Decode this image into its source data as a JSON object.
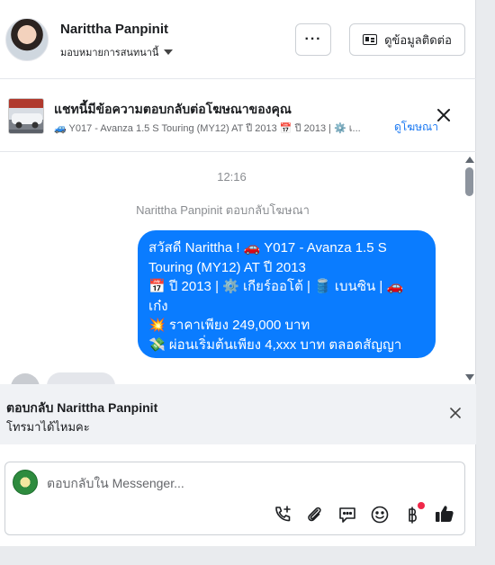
{
  "header": {
    "name": "Narittha Panpinit",
    "assign_label": "มอบหมายการสนทนานี้",
    "more_label": "···",
    "contact_label": "ดูข้อมูลติดต่อ"
  },
  "ad_banner": {
    "title": "แชทนี้มีข้อความตอบกลับต่อโฆษณาของคุณ",
    "subtitle": "🚙 Y017 - Avanza 1.5 S Touring (MY12) AT ปี 2013 📅 ปี 2013 | ⚙️ เ...",
    "link_label": "ดูโฆษณา"
  },
  "messages": {
    "timestamp": "12:16",
    "reply_note": "Narittha Panpinit ตอบกลับโฆษณา",
    "bubble_lines": [
      "สวัสดี Narittha ! 🚗 Y017 - Avanza 1.5 S",
      "Touring (MY12) AT ปี 2013",
      "📅 ปี 2013 | ⚙️ เกียร์ออโต้ | 🛢️ เบนซิน | 🚗",
      "เก๋ง",
      "💥 ราคาเพียง 249,000 บาท",
      "💸 ผ่อนเริ่มต้นเพียง 4,xxx บาท ตลอดสัญญา"
    ]
  },
  "reply_to": {
    "title": "ตอบกลับ Narittha Panpinit",
    "text": "โทรมาได้ไหมคะ"
  },
  "composer": {
    "placeholder": "ตอบกลับใน Messenger..."
  },
  "colors": {
    "bubble": "#0a7cff",
    "link": "#1877f2",
    "notification_dot": "#f02849"
  },
  "icons": [
    "call-add-icon",
    "attachment-icon",
    "chat-icon",
    "emoji-icon",
    "baht-icon",
    "thumbs-up-icon",
    "close-icon",
    "more-icon",
    "contact-card-icon",
    "caret-down-icon"
  ]
}
